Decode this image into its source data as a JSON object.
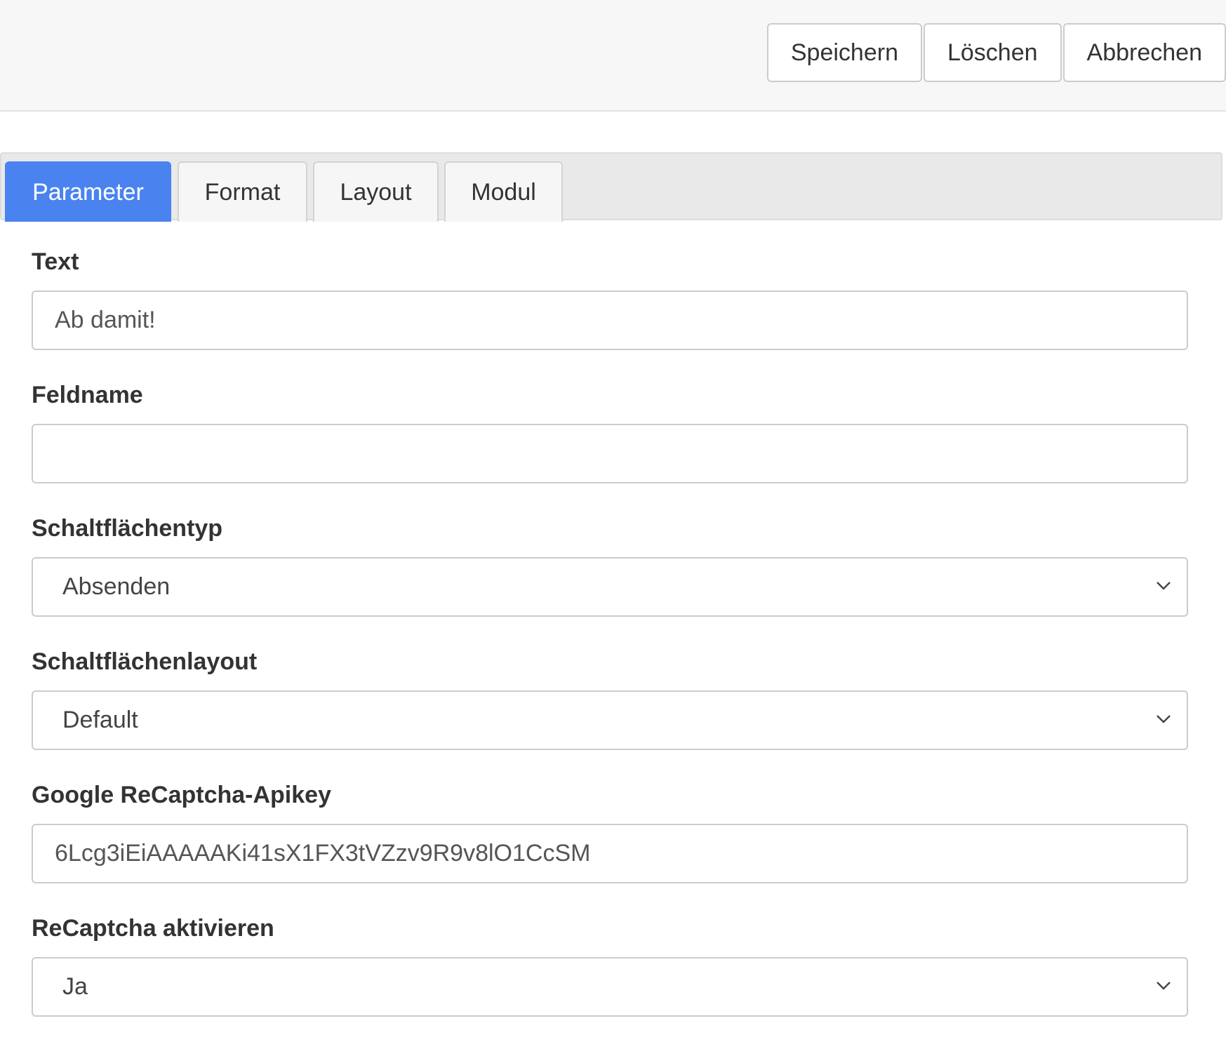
{
  "toolbar": {
    "save_label": "Speichern",
    "delete_label": "Löschen",
    "cancel_label": "Abbrechen"
  },
  "tabs": [
    {
      "label": "Parameter",
      "active": true
    },
    {
      "label": "Format",
      "active": false
    },
    {
      "label": "Layout",
      "active": false
    },
    {
      "label": "Modul",
      "active": false
    }
  ],
  "fields": {
    "text": {
      "label": "Text",
      "value": "Ab damit!"
    },
    "feldname": {
      "label": "Feldname",
      "value": ""
    },
    "schaltflaechentyp": {
      "label": "Schaltflächentyp",
      "value": "Absenden"
    },
    "schaltflaechenlayout": {
      "label": "Schaltflächenlayout",
      "value": "Default"
    },
    "recaptcha_apikey": {
      "label": "Google ReCaptcha-Apikey",
      "value": "6Lcg3iEiAAAAAKi41sX1FX3tVZzv9R9v8lO1CcSM"
    },
    "recaptcha_aktivieren": {
      "label": "ReCaptcha aktivieren",
      "value": "Ja"
    }
  },
  "icons": {
    "select_arrow": "chevron-down-icon"
  },
  "colors": {
    "accent": "#4a83f0",
    "toolbar_bg": "#f7f7f7",
    "tabbar_bg": "#e9e9e9"
  }
}
